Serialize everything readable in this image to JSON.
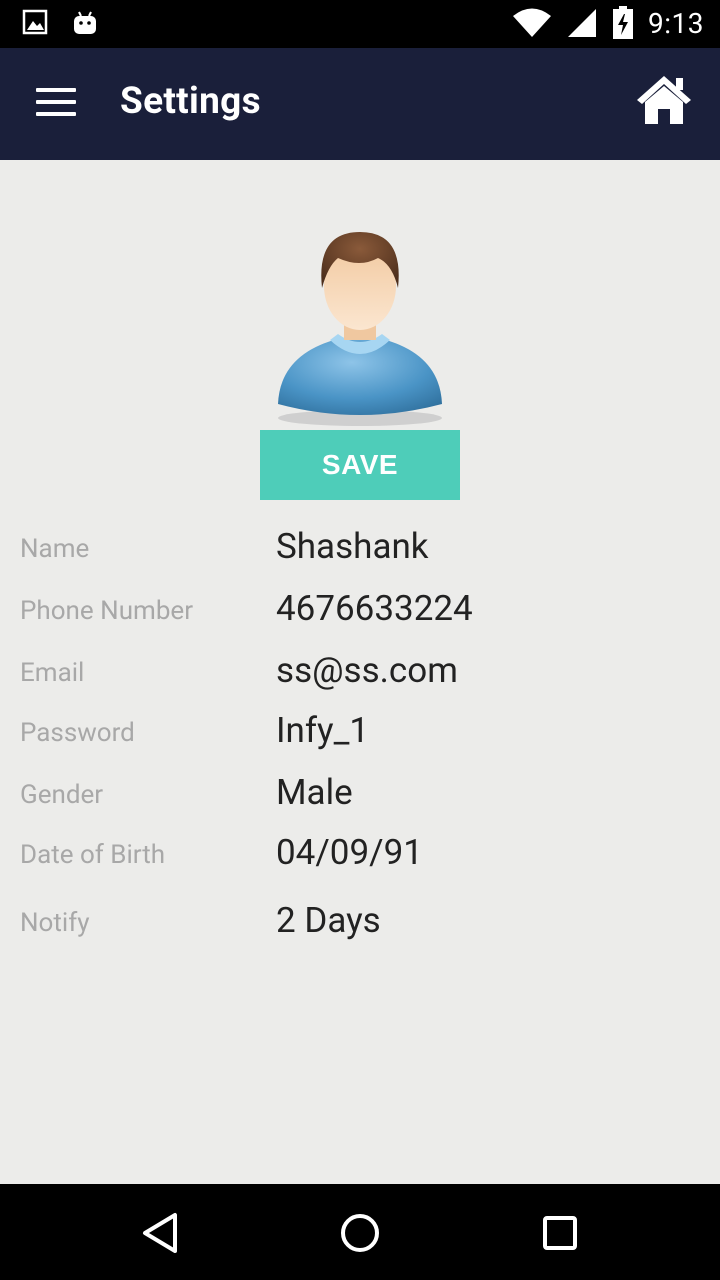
{
  "status_bar": {
    "time": "9:13"
  },
  "app_bar": {
    "title": "Settings"
  },
  "actions": {
    "save_label": "SAVE"
  },
  "fields": [
    {
      "label": "Name",
      "value": "Shashank"
    },
    {
      "label": "Phone Number",
      "value": "4676633224"
    },
    {
      "label": "Email",
      "value": "ss@ss.com"
    },
    {
      "label": "Password",
      "value": "Infy_1"
    },
    {
      "label": "Gender",
      "value": "Male"
    },
    {
      "label": "Date of Birth",
      "value": "04/09/91"
    },
    {
      "label": "Notify",
      "value": "2 Days"
    }
  ],
  "colors": {
    "app_bar": "#1a1f3a",
    "background": "#ececea",
    "save_button": "#4ecdb9",
    "label_text": "#a8a8a8",
    "value_text": "#222222"
  },
  "icons": {
    "status_left": [
      "image-icon",
      "android-icon"
    ],
    "status_right": [
      "wifi-icon",
      "signal-icon",
      "battery-icon"
    ],
    "app_bar": [
      "menu-icon",
      "home-icon"
    ],
    "nav": [
      "back-icon",
      "home-circle-icon",
      "recents-icon"
    ]
  }
}
